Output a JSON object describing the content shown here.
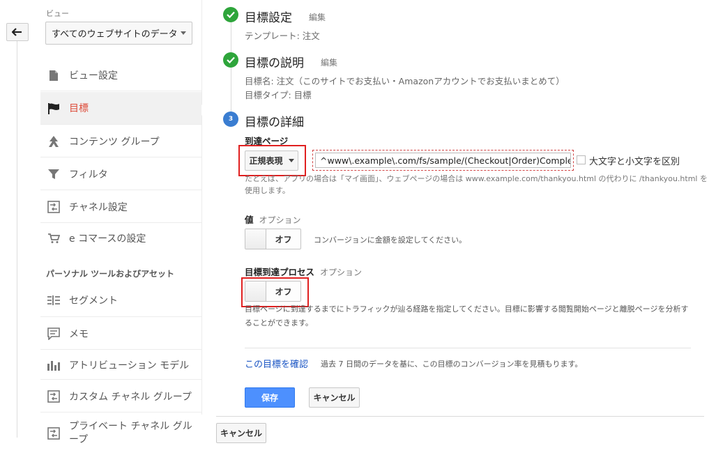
{
  "sidebar": {
    "view_label": "ビュー",
    "view_select_value": "すべてのウェブサイトのデータ",
    "items": [
      {
        "label": "ビュー設定",
        "icon": "page-icon"
      },
      {
        "label": "目標",
        "icon": "flag-icon"
      },
      {
        "label": "コンテンツ グループ",
        "icon": "content-group-icon"
      },
      {
        "label": "フィルタ",
        "icon": "filter-icon"
      },
      {
        "label": "チャネル設定",
        "icon": "channel-icon"
      },
      {
        "label": "e コマースの設定",
        "icon": "cart-icon"
      }
    ],
    "section_title": "パーソナル ツールおよびアセット",
    "personal_items": [
      {
        "label": "セグメント",
        "icon": "segment-icon"
      },
      {
        "label": "メモ",
        "icon": "memo-icon"
      },
      {
        "label": "アトリビューション モデル",
        "icon": "bar-chart-icon"
      },
      {
        "label": "カスタム チャネル グループ",
        "icon": "channel-icon"
      },
      {
        "label": "プライベート チャネル グループ",
        "icon": "channel-icon"
      }
    ]
  },
  "steps": {
    "goal_setup": {
      "title": "目標設定",
      "edit": "編集",
      "detail": "テンプレート: 注文"
    },
    "goal_description": {
      "title": "目標の説明",
      "edit": "編集",
      "name_line": "目標名: 注文（このサイトでお支払い・Amazonアカウントでお支払いまとめて）",
      "type_line": "目標タイプ: 目標"
    },
    "goal_details": {
      "number": "3",
      "title": "目標の詳細"
    }
  },
  "destination": {
    "label": "到達ページ",
    "match_type": "正規表現",
    "value": "^www\\.example\\.com/fs/sample/(Checkout|Order)Complete\\.html",
    "case_sensitive_label": "大文字と小文字を区別",
    "help_line1": "たとえば、アプリの場合は「マイ画面」、ウェブページの場合は www.example.com/thankyou.html の代わりに /thankyou.html を",
    "help_line2": "使用します。"
  },
  "value_field": {
    "label": "値",
    "optional": "オプション",
    "toggle": "オフ",
    "help": "コンバージョンに金額を設定してください。"
  },
  "funnel": {
    "label": "目標到達プロセス",
    "optional": "オプション",
    "toggle": "オフ",
    "help_line1": "目標ページに到達するまでにトラフィックが辿る経路を指定してください。目標に影響する閲覧開始ページと離脱ページを分析す",
    "help_line2": "ることができます。"
  },
  "verify": {
    "link": "この目標を確認",
    "help": "過去 7 日間のデータを基に、この目標のコンバージョン率を見積もります。"
  },
  "actions": {
    "save": "保存",
    "cancel": "キャンセル",
    "cancel_outer": "キャンセル"
  },
  "colors": {
    "accent_blue": "#4d90fe",
    "active_red": "#dd4b39",
    "success_green": "#2ea53b",
    "highlight_red": "#e02020"
  }
}
